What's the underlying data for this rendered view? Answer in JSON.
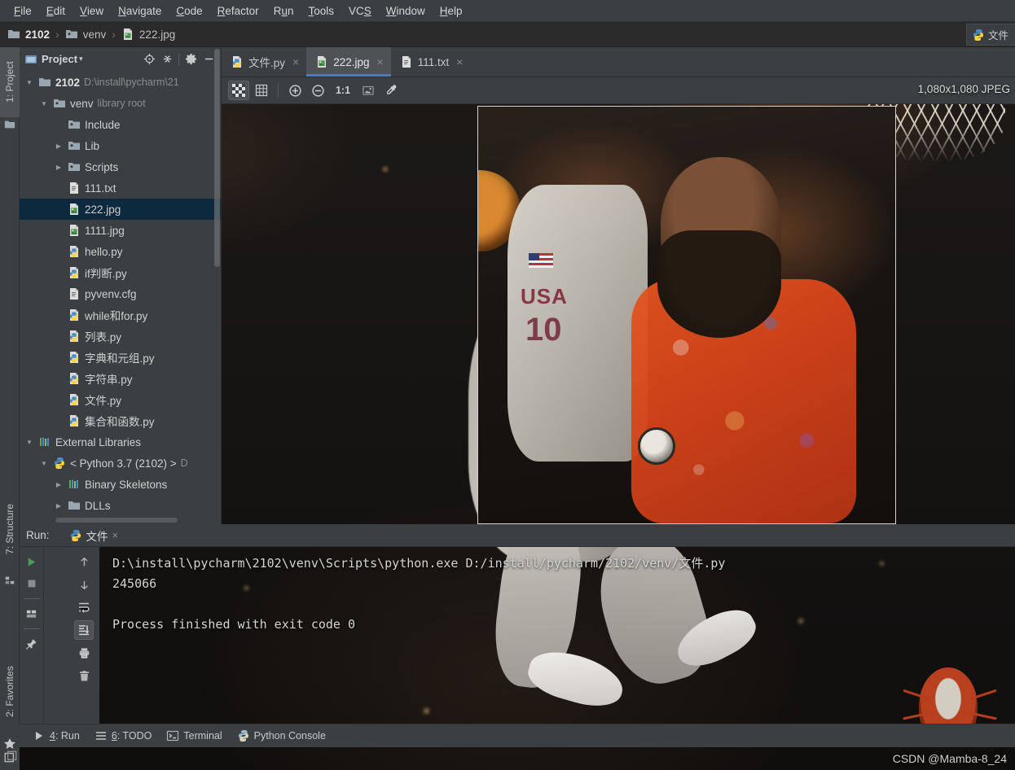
{
  "menubar": {
    "items": [
      {
        "label": "File",
        "mnemonic": "F"
      },
      {
        "label": "Edit",
        "mnemonic": "E"
      },
      {
        "label": "View",
        "mnemonic": "V"
      },
      {
        "label": "Navigate",
        "mnemonic": "N"
      },
      {
        "label": "Code",
        "mnemonic": "C"
      },
      {
        "label": "Refactor",
        "mnemonic": "R"
      },
      {
        "label": "Run",
        "mnemonic": "u"
      },
      {
        "label": "Tools",
        "mnemonic": "T"
      },
      {
        "label": "VCS",
        "mnemonic": "S"
      },
      {
        "label": "Window",
        "mnemonic": "W"
      },
      {
        "label": "Help",
        "mnemonic": "H"
      }
    ]
  },
  "breadcrumb": {
    "items": [
      "2102",
      "venv",
      "222.jpg"
    ],
    "separator": "›"
  },
  "right_tool_tab": {
    "label": "文件"
  },
  "left_strip": {
    "project_tab": "1: Project",
    "structure_tab": "7: Structure",
    "favorites_tab": "2: Favorites"
  },
  "project_panel": {
    "title": "Project",
    "caret": "▾",
    "buttons": [
      "locate-button",
      "collapse-all-button",
      "settings-button",
      "hide-button"
    ],
    "tree": [
      {
        "indent": 0,
        "arrow": "▼",
        "icon": "folder-icon",
        "label": "2102",
        "bold": true,
        "secondary": "D:\\install\\pycharm\\21",
        "selected": false
      },
      {
        "indent": 1,
        "arrow": "▼",
        "icon": "venv-folder-icon",
        "label": "venv",
        "bold": false,
        "secondary": "library root",
        "selected": false
      },
      {
        "indent": 2,
        "arrow": "",
        "icon": "venv-folder-icon",
        "label": "Include",
        "bold": false,
        "secondary": "",
        "selected": false
      },
      {
        "indent": 2,
        "arrow": "▶",
        "icon": "venv-folder-icon",
        "label": "Lib",
        "bold": false,
        "secondary": "",
        "selected": false
      },
      {
        "indent": 2,
        "arrow": "▶",
        "icon": "venv-folder-icon",
        "label": "Scripts",
        "bold": false,
        "secondary": "",
        "selected": false
      },
      {
        "indent": 2,
        "arrow": "",
        "icon": "text-file-icon",
        "label": "111.txt",
        "bold": false,
        "secondary": "",
        "selected": false
      },
      {
        "indent": 2,
        "arrow": "",
        "icon": "image-file-icon",
        "label": "222.jpg",
        "bold": false,
        "secondary": "",
        "selected": true
      },
      {
        "indent": 2,
        "arrow": "",
        "icon": "image-file-icon",
        "label": "1111.jpg",
        "bold": false,
        "secondary": "",
        "selected": false
      },
      {
        "indent": 2,
        "arrow": "",
        "icon": "python-file-icon",
        "label": "hello.py",
        "bold": false,
        "secondary": "",
        "selected": false
      },
      {
        "indent": 2,
        "arrow": "",
        "icon": "python-file-icon",
        "label": "if判断.py",
        "bold": false,
        "secondary": "",
        "selected": false
      },
      {
        "indent": 2,
        "arrow": "",
        "icon": "text-file-icon",
        "label": "pyvenv.cfg",
        "bold": false,
        "secondary": "",
        "selected": false
      },
      {
        "indent": 2,
        "arrow": "",
        "icon": "python-file-icon",
        "label": "while和for.py",
        "bold": false,
        "secondary": "",
        "selected": false
      },
      {
        "indent": 2,
        "arrow": "",
        "icon": "python-file-icon",
        "label": "列表.py",
        "bold": false,
        "secondary": "",
        "selected": false
      },
      {
        "indent": 2,
        "arrow": "",
        "icon": "python-file-icon",
        "label": "字典和元组.py",
        "bold": false,
        "secondary": "",
        "selected": false
      },
      {
        "indent": 2,
        "arrow": "",
        "icon": "python-file-icon",
        "label": "字符串.py",
        "bold": false,
        "secondary": "",
        "selected": false
      },
      {
        "indent": 2,
        "arrow": "",
        "icon": "python-file-icon",
        "label": "文件.py",
        "bold": false,
        "secondary": "",
        "selected": false
      },
      {
        "indent": 2,
        "arrow": "",
        "icon": "python-file-icon",
        "label": "集合和函数.py",
        "bold": false,
        "secondary": "",
        "selected": false
      },
      {
        "indent": 0,
        "arrow": "▼",
        "icon": "library-icon",
        "label": "External Libraries",
        "bold": false,
        "secondary": "",
        "selected": false
      },
      {
        "indent": 1,
        "arrow": "▼",
        "icon": "python-icon",
        "label": "< Python 3.7 (2102) >",
        "bold": false,
        "secondary": "D",
        "selected": false
      },
      {
        "indent": 2,
        "arrow": "▶",
        "icon": "library-icon",
        "label": "Binary Skeletons",
        "bold": false,
        "secondary": "",
        "selected": false
      },
      {
        "indent": 2,
        "arrow": "▶",
        "icon": "folder-icon",
        "label": "DLLs",
        "bold": false,
        "secondary": "",
        "selected": false
      }
    ]
  },
  "editor": {
    "tabs": [
      {
        "label": "文件.py",
        "icon": "python-file-icon",
        "active": false
      },
      {
        "label": "222.jpg",
        "icon": "image-file-icon",
        "active": true
      },
      {
        "label": "111.txt",
        "icon": "text-file-icon",
        "active": false
      }
    ],
    "close_glyph": "×",
    "toolbar": [
      {
        "name": "toggle-transparency-button",
        "type": "checker",
        "active": true
      },
      {
        "name": "toggle-grid-button",
        "type": "grid",
        "active": false
      },
      {
        "name": "zoom-in-button",
        "type": "plus",
        "active": false
      },
      {
        "name": "zoom-out-button",
        "type": "minus",
        "active": false
      },
      {
        "name": "actual-size-button",
        "type": "text",
        "text": "1:1",
        "active": false
      },
      {
        "name": "fit-to-window-button",
        "type": "fit",
        "active": false
      },
      {
        "name": "color-picker-button",
        "type": "dropper",
        "active": false
      }
    ],
    "image_info": "1,080x1,080 JPEG"
  },
  "run_panel": {
    "label": "Run:",
    "tab_label": "文件",
    "close_glyph": "×",
    "left_buttons": [
      {
        "name": "rerun-button",
        "glyph": "▶"
      },
      {
        "name": "stop-button",
        "glyph": "■"
      },
      {
        "name": "layout-button",
        "glyph": "layout"
      },
      {
        "name": "pin-tab-button",
        "glyph": "pin"
      }
    ],
    "gutter_buttons": [
      {
        "name": "up-the-stack-trace-button",
        "glyph": "↑"
      },
      {
        "name": "down-the-stack-trace-button",
        "glyph": "↓"
      },
      {
        "name": "soft-wrap-button",
        "glyph": "wrap"
      },
      {
        "name": "scroll-to-end-button",
        "glyph": "scrollend",
        "active": true
      },
      {
        "name": "print-button",
        "glyph": "print"
      },
      {
        "name": "clear-all-button",
        "glyph": "trash"
      }
    ],
    "console_lines": [
      "D:\\install\\pycharm\\2102\\venv\\Scripts\\python.exe D:/install/pycharm/2102/venv/文件.py",
      "245066",
      "",
      "Process finished with exit code 0"
    ]
  },
  "statusbar": {
    "items": [
      {
        "label": "4: Run",
        "mnemonic": "4",
        "icon": "run-icon"
      },
      {
        "label": "6: TODO",
        "mnemonic": "6",
        "icon": "todo-icon"
      },
      {
        "label": "Terminal",
        "mnemonic": "",
        "icon": "terminal-icon"
      },
      {
        "label": "Python Console",
        "mnemonic": "",
        "icon": "python-icon"
      }
    ]
  },
  "watermark": {
    "text": "CSDN @Mamba-8_24"
  },
  "colors": {
    "chrome": "#3c3f41",
    "editor_bg": "#2b2b2b",
    "selection": "#0d293e",
    "accent": "#3d7cc9",
    "text": "#bbbbbb",
    "text_dim": "#8c8c8c",
    "run_green": "#499c54"
  }
}
